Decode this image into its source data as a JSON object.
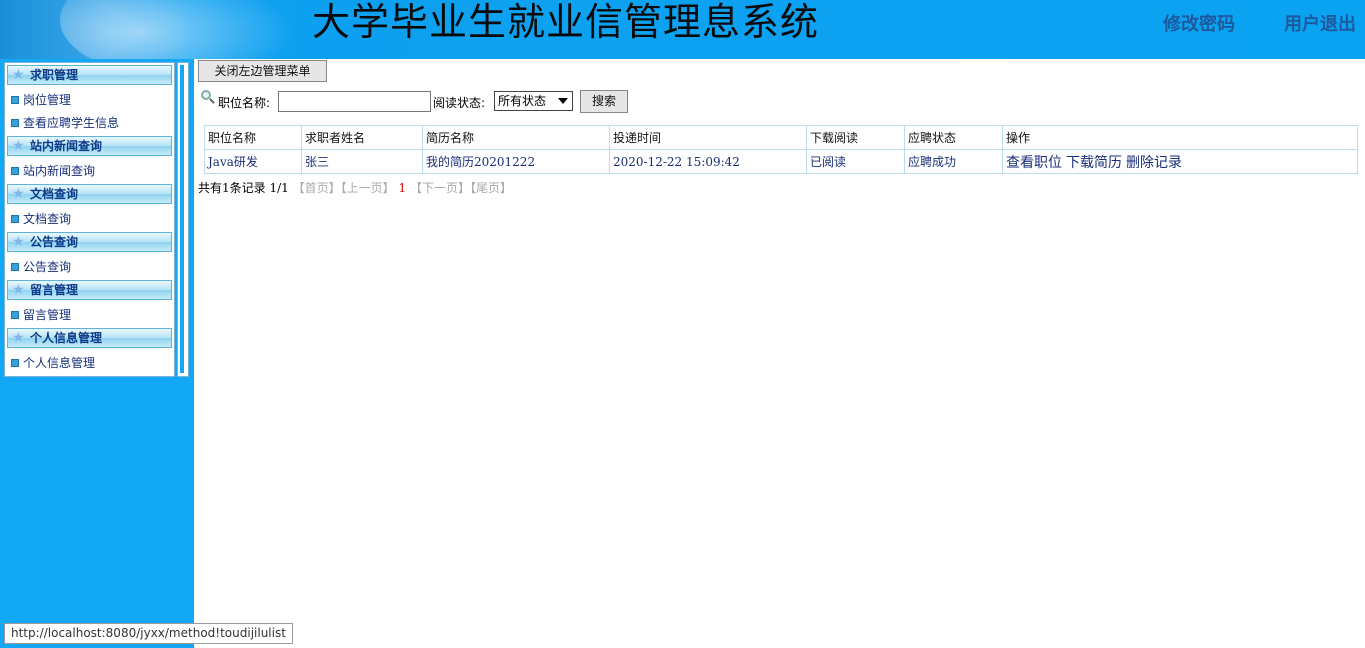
{
  "header": {
    "title": "大学毕业生就业信管理息系统",
    "change_password": "修改密码",
    "logout": "用户退出"
  },
  "sidebar": {
    "groups": [
      {
        "title": "求职管理",
        "items": [
          "岗位管理",
          "查看应聘学生信息"
        ]
      },
      {
        "title": "站内新闻查询",
        "items": [
          "站内新闻查询"
        ]
      },
      {
        "title": "文档查询",
        "items": [
          "文档查询"
        ]
      },
      {
        "title": "公告查询",
        "items": [
          "公告查询"
        ]
      },
      {
        "title": "留言管理",
        "items": [
          "留言管理"
        ]
      },
      {
        "title": "个人信息管理",
        "items": [
          "个人信息管理"
        ]
      }
    ]
  },
  "toolbar": {
    "close_menu": "关闭左边管理菜单",
    "position_label": "职位名称:",
    "position_value": "",
    "read_status_label": "阅读状态:",
    "read_status_selected": "所有状态",
    "search_button": "搜索"
  },
  "table": {
    "columns": [
      "职位名称",
      "求职者姓名",
      "简历名称",
      "投递时间",
      "下载阅读",
      "应聘状态",
      "操作"
    ],
    "rows": [
      {
        "position": "Java研发",
        "applicant": "张三",
        "resume": "我的简历20201222",
        "time": "2020-12-22 15:09:42",
        "read": "已阅读",
        "status": "应聘成功",
        "ops": [
          "查看职位",
          "下载简历",
          "删除记录"
        ]
      }
    ]
  },
  "pager": {
    "total": "共有1条记录",
    "pages": "1/1",
    "first": "【首页】",
    "prev": "【上一页】",
    "current": "1",
    "next": "【下一页】",
    "last": "【尾页】"
  },
  "statusbar": {
    "url": "http://localhost:8080/jyxx/method!toudijilulist"
  },
  "colors": {
    "header_bg": "#0aa3f2",
    "sidebar_bg": "#12a8f5",
    "menu_head_text": "#0b3a88",
    "pager_current": "#dd0000"
  }
}
